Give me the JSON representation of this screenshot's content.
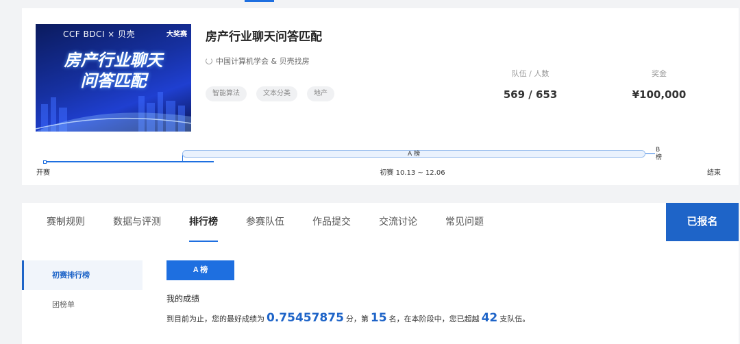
{
  "banner": {
    "logo_text": "CCF BDCI × 贝壳",
    "badge": "大奖赛",
    "title_line1": "房产行业聊天",
    "title_line2": "问答匹配"
  },
  "competition": {
    "title": "房产行业聊天问答匹配",
    "organizer": "中国计算机学会 & 贝壳找房",
    "tags": [
      "智能算法",
      "文本分类",
      "地产"
    ]
  },
  "stats": {
    "teams_label": "队伍 / 人数",
    "teams_value": "569 / 653",
    "prize_label": "奖金",
    "prize_value": "¥100,000"
  },
  "timeline": {
    "start_label": "开赛",
    "a_board_label": "A 榜",
    "b_board_label": "B 榜",
    "stage_label": "初赛 10.13 ~ 12.06",
    "end_label": "结束"
  },
  "tabs": [
    {
      "label": "赛制规则"
    },
    {
      "label": "数据与评测"
    },
    {
      "label": "排行榜"
    },
    {
      "label": "参赛队伍"
    },
    {
      "label": "作品提交"
    },
    {
      "label": "交流讨论"
    },
    {
      "label": "常见问题"
    }
  ],
  "signup_label": "已报名",
  "sidenav": [
    {
      "label": "初赛排行榜"
    },
    {
      "label": "团榜单"
    }
  ],
  "leaderboard": {
    "board_button": "A 榜",
    "my_score_title": "我的成绩",
    "text_prefix": "到目前为止，您的最好成绩为",
    "best_score": "0.75457875",
    "text_points": "分，第",
    "rank": "15",
    "text_rank_suffix": "名，在本阶段中，您已超越",
    "surpassed": "42",
    "text_suffix": "支队伍。"
  },
  "colors": {
    "accent": "#1e6fe0",
    "button_dark": "#1e64c8"
  }
}
